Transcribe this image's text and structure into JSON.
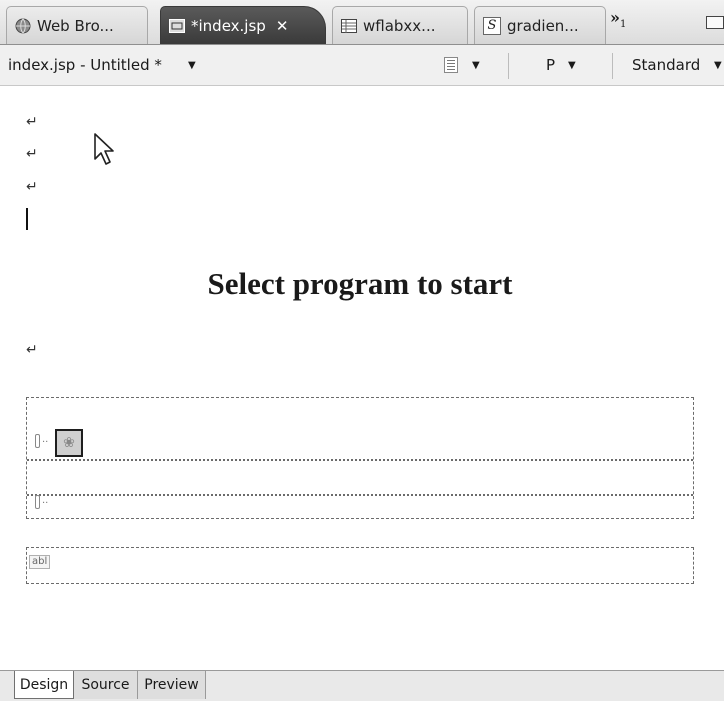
{
  "editor_tabs": [
    {
      "label": "Web Bro...",
      "icon": "globe-icon",
      "active": false
    },
    {
      "label": "*index.jsp",
      "icon": "jsp-file-icon",
      "active": true,
      "close": "✕"
    },
    {
      "label": "wflabxx...",
      "icon": "table-file-icon",
      "active": false
    },
    {
      "label": "gradien...",
      "icon": "s-file-icon",
      "icon_text": "S",
      "active": false
    }
  ],
  "overflow": {
    "symbol": "»",
    "count": "1"
  },
  "toolbar": {
    "document_title": "index.jsp - Untitled *",
    "paragraph_format": "P",
    "view_mode": "Standard"
  },
  "canvas": {
    "heading": "Select program to start",
    "return_marker": "↵",
    "input_placeholder": "abl"
  },
  "bottom_tabs": [
    {
      "label": "Design",
      "active": true
    },
    {
      "label": "Source",
      "active": false
    },
    {
      "label": "Preview",
      "active": false
    }
  ],
  "colors": {
    "active_tab_bg": "#4a4a4a",
    "tab_bg": "#e0e0e0",
    "canvas_bg": "#ffffff",
    "dashed_border": "#6b6b6b"
  }
}
